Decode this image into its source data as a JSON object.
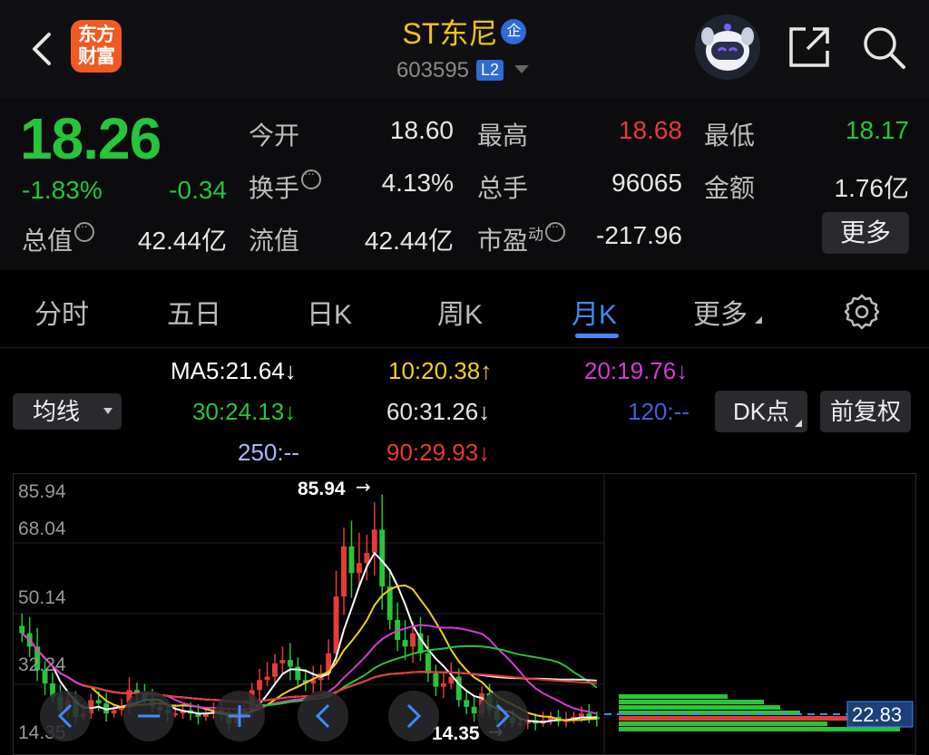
{
  "header": {
    "logo_line1": "东方",
    "logo_line2": "财富",
    "title": "ST东尼",
    "title_badge": "企",
    "code": "603595",
    "level_badge": "L2"
  },
  "quote": {
    "price": "18.26",
    "change_pct": "-1.83%",
    "change": "-0.34",
    "open_label": "今开",
    "open": "18.60",
    "high_label": "最高",
    "high": "18.68",
    "low_label": "最低",
    "low": "18.17",
    "turnover_label": "换手",
    "turnover": "4.13%",
    "volume_label": "总手",
    "volume": "96065",
    "amount_label": "金额",
    "amount": "1.76亿",
    "total_cap_label": "总值",
    "total_cap": "42.44亿",
    "float_cap_label": "流值",
    "float_cap": "42.44亿",
    "pe_label": "市盈",
    "pe_sup": "动",
    "pe": "-217.96",
    "more_label": "更多"
  },
  "tabs": [
    {
      "label": "分时"
    },
    {
      "label": "五日"
    },
    {
      "label": "日K"
    },
    {
      "label": "周K"
    },
    {
      "label": "月K"
    },
    {
      "label": "更多"
    }
  ],
  "indicators": {
    "ma_select": "均线",
    "ma5": "MA5:21.64↓",
    "ma10": "10:20.38↑",
    "ma20": "20:19.76↓",
    "ma30": "30:24.13↓",
    "ma60": "60:31.26↓",
    "ma120": "120:--",
    "ma250": "250:--",
    "ma90": "90:29.93↓",
    "dk_button": "DK点",
    "adjust_button": "前复权"
  },
  "colors": {
    "up": "#e83a3a",
    "down": "#26c53a",
    "accent": "#3f8cf5",
    "ma5": "#ffffff",
    "ma10": "#f0d020",
    "ma20": "#d63ad6",
    "ma30": "#26c53a",
    "ma60": "#e6e6e6",
    "ma120": "#4a5ed6",
    "ma250": "#a9b8ff",
    "ma90": "#e83a3a"
  },
  "chart_data": {
    "type": "candlestick",
    "y_labels": [
      "85.94",
      "68.04",
      "50.14",
      "32.24",
      "14.35"
    ],
    "ylim": [
      14.35,
      85.94
    ],
    "max_marker": "85.94",
    "min_marker": "14.35",
    "chip_price_marker": "22.83",
    "closes": [
      44,
      40,
      33,
      29,
      25,
      21,
      24,
      19,
      20,
      24,
      23,
      20,
      21,
      22,
      27,
      26,
      24,
      22,
      21,
      20,
      20,
      21,
      20,
      19,
      20,
      21,
      20,
      17,
      19,
      21,
      27,
      30,
      31,
      35,
      36,
      34,
      30,
      29,
      30,
      32,
      38,
      55,
      70,
      62,
      65,
      68,
      75,
      58,
      48,
      42,
      40,
      44,
      38,
      32,
      28,
      29,
      31,
      24,
      22,
      20,
      26,
      21,
      18,
      19,
      17,
      17,
      18,
      17,
      18,
      19,
      18,
      18,
      19,
      20,
      19,
      18.26
    ],
    "ma_lines": [
      "MA5",
      "MA10",
      "MA20",
      "MA30",
      "MA60",
      "MA90"
    ]
  }
}
